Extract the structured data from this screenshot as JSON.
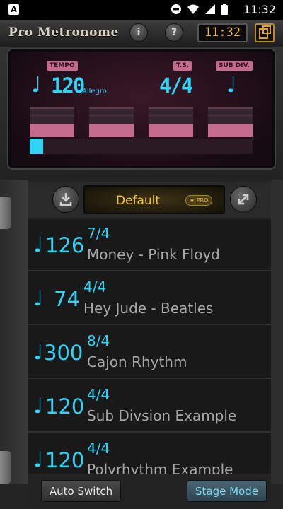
{
  "status_bar": {
    "time": "11:32",
    "app_badge": "A"
  },
  "app": {
    "title": "Pro Metronome",
    "info_label": "i",
    "help_label": "?",
    "clock": "11:32"
  },
  "display": {
    "tempo_label": "TEMPO",
    "ts_label": "T.S.",
    "subdiv_label": "SUB DIV.",
    "bpm": "120",
    "tempo_name": "Allegro",
    "time_signature": "4/4",
    "beat_progress": 0.06,
    "beats_count": 4
  },
  "preset": {
    "name": "Default",
    "pro_badge": "PRO"
  },
  "songs": [
    {
      "bpm": "126",
      "ts": "7/4",
      "name": "Money - Pink Floyd"
    },
    {
      "bpm": "74",
      "ts": "4/4",
      "name": "Hey Jude - Beatles"
    },
    {
      "bpm": "300",
      "ts": "8/4",
      "name": "Cajon Rhythm"
    },
    {
      "bpm": "120",
      "ts": "4/4",
      "name": "Sub Divsion Example"
    },
    {
      "bpm": "120",
      "ts": "4/4",
      "name": "Polyrhythm Example"
    }
  ],
  "bottom": {
    "auto_switch": "Auto Switch",
    "stage_mode": "Stage Mode"
  },
  "colors": {
    "accent_cyan": "#2ed3f5",
    "accent_pink": "#c46b8e",
    "accent_gold": "#f2c438"
  }
}
